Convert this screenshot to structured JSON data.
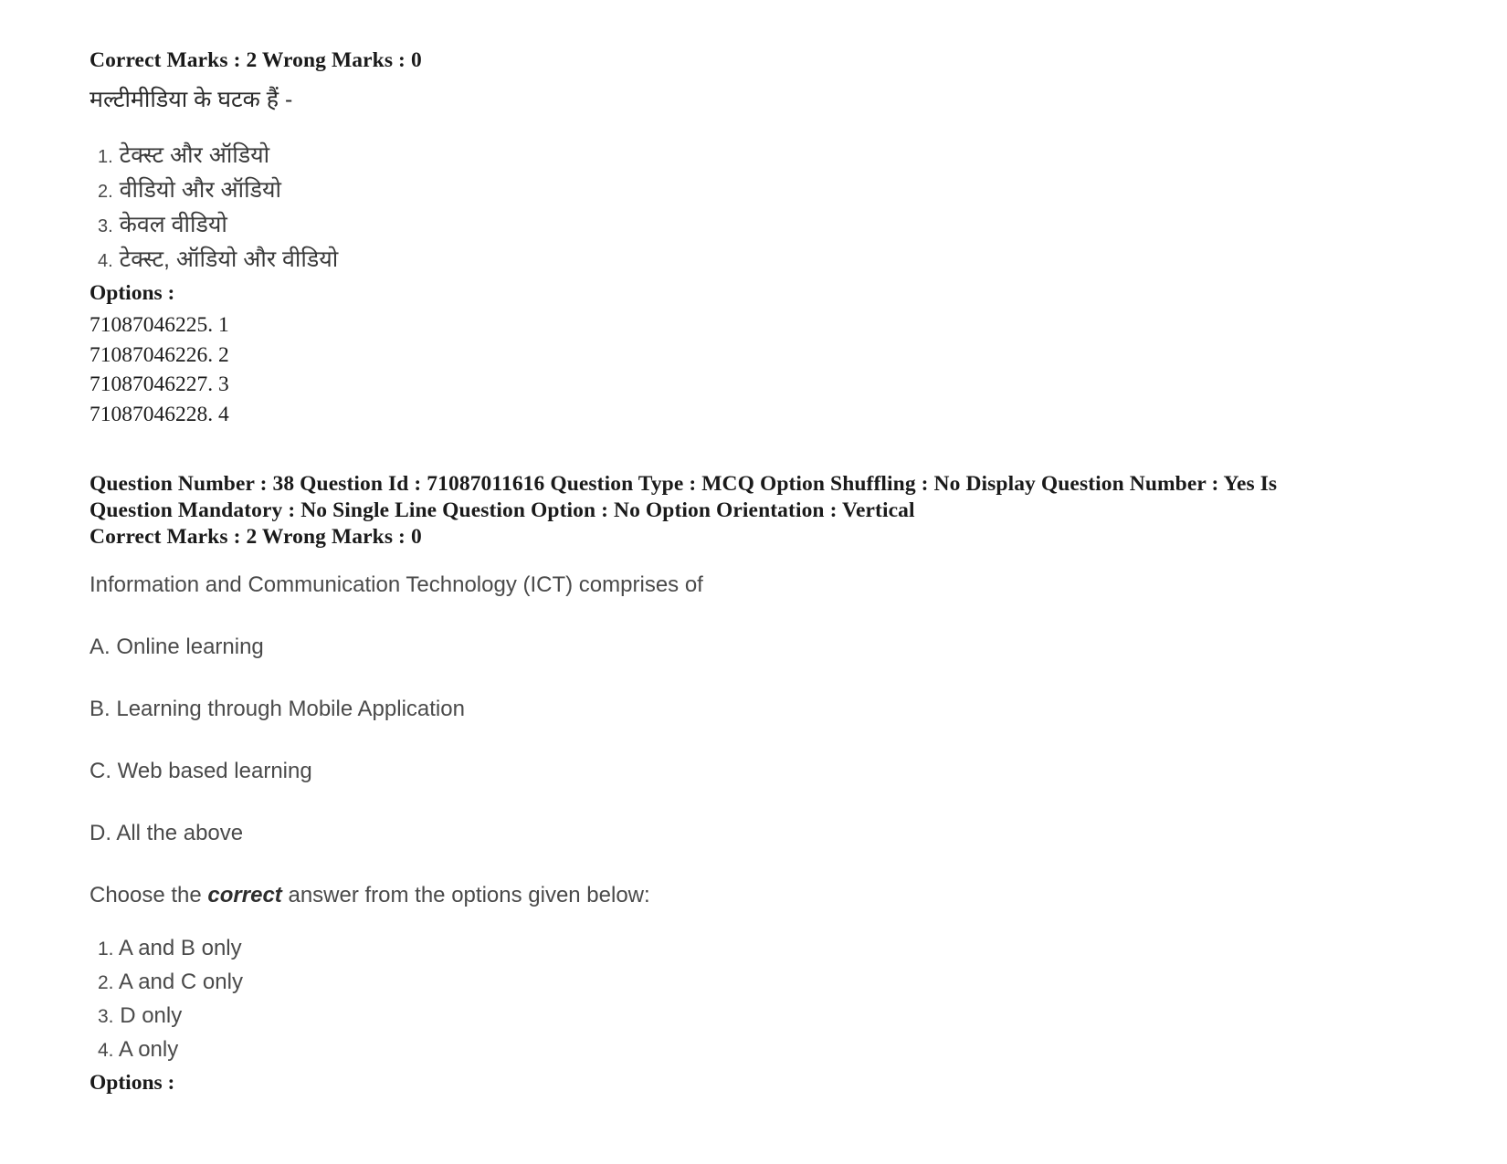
{
  "question_37": {
    "marks_line": "Correct Marks : 2 Wrong Marks : 0",
    "stem": "मल्टीमीडिया के घटक हैं -",
    "choices": [
      {
        "num": "1.",
        "text": "टेक्स्ट और ऑडियो"
      },
      {
        "num": "2.",
        "text": "वीडियो और ऑडियो"
      },
      {
        "num": "3.",
        "text": "केवल वीडियो"
      },
      {
        "num": "4.",
        "text": "टेक्स्ट, ऑडियो और वीडियो"
      }
    ],
    "options_label": "Options :",
    "option_ids": [
      "71087046225. 1",
      "71087046226. 2",
      "71087046227. 3",
      "71087046228. 4"
    ]
  },
  "question_38": {
    "meta_line_1": "Question Number : 38 Question Id : 71087011616 Question Type : MCQ Option Shuffling : No Display Question Number : Yes Is",
    "meta_line_2": "Question Mandatory : No Single Line Question Option : No Option Orientation : Vertical",
    "marks_line": "Correct Marks : 2 Wrong Marks : 0",
    "stem": "Information and Communication Technology (ICT) comprises of",
    "items": [
      "A. Online learning",
      "B. Learning through Mobile Application",
      "C. Web based learning",
      "D. All the above"
    ],
    "choose_prefix": "Choose the ",
    "choose_emphasis": "correct",
    "choose_suffix": " answer from the options given below:",
    "choices": [
      {
        "num": "1.",
        "text": "A and B only"
      },
      {
        "num": "2.",
        "text": "A and C only"
      },
      {
        "num": "3.",
        "text": "D only"
      },
      {
        "num": "4.",
        "text": "A only"
      }
    ],
    "options_label": "Options :"
  }
}
